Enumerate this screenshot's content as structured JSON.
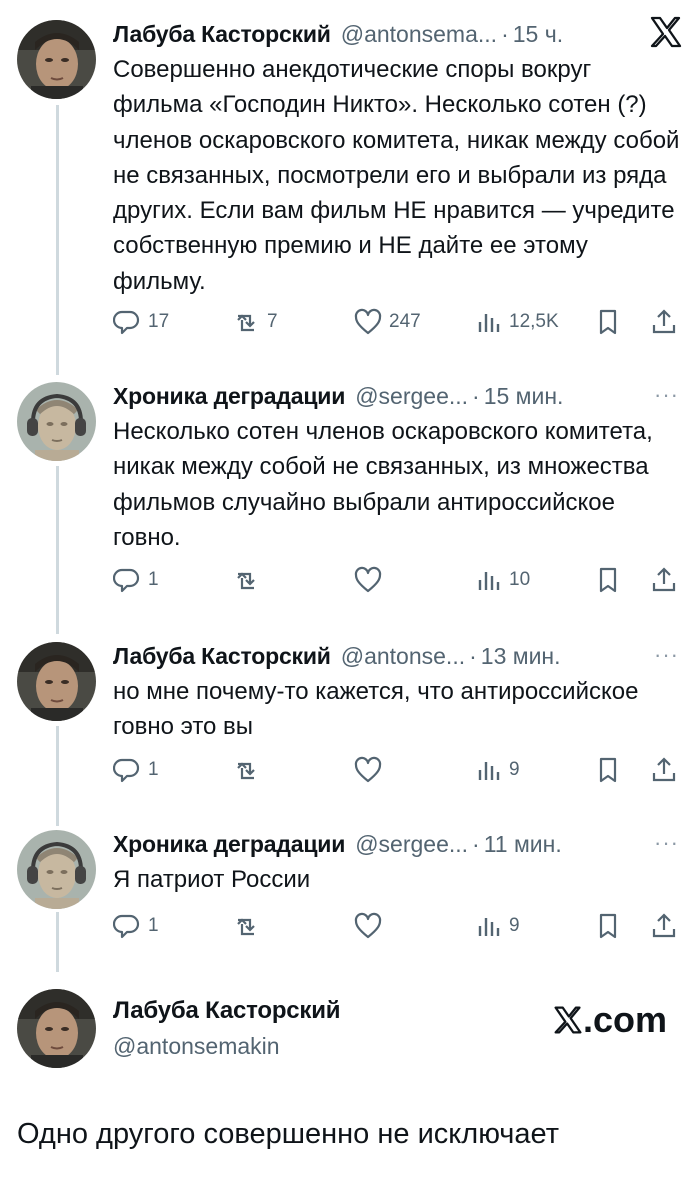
{
  "tweets": [
    {
      "author": "Лабуба Касторский",
      "handle": "@antonsema...",
      "time": "15 ч.",
      "text": "Совершенно анекдотические споры вокруг фильма «Господин Никто». Несколько сотен (?) членов оскаровского комитета, никак между собой не связанных, посмотрели его и выбрали из ряда других. Если вам фильм НЕ нравится — учредите собственную премию и НЕ дайте ее этому фильму.",
      "replies": "17",
      "retweets": "7",
      "likes": "247",
      "views": "12,5K"
    },
    {
      "author": "Хроника деградации",
      "handle": "@sergee...",
      "time": "15 мин.",
      "text": "Несколько сотен членов оскаровского комитета, никак между собой не связанных, из множества фильмов случайно выбрали антироссийское говно.",
      "replies": "1",
      "retweets": "",
      "likes": "",
      "views": "10"
    },
    {
      "author": "Лабуба Касторский",
      "handle": "@antonse...",
      "time": "13 мин.",
      "text": "но мне почему-то кажется, что антироссийское говно это вы",
      "replies": "1",
      "retweets": "",
      "likes": "",
      "views": "9"
    },
    {
      "author": "Хроника деградации",
      "handle": "@sergee...",
      "time": "11 мин.",
      "text": "Я патриот России",
      "replies": "1",
      "retweets": "",
      "likes": "",
      "views": "9"
    }
  ],
  "card": {
    "author": "Лабуба Касторский",
    "handle": "@antonsemakin",
    "brand": ".com"
  },
  "caption": "Одно другого совершенно не исключает",
  "icons": {
    "more": "more-icon",
    "x_logo": "x-logo-icon"
  },
  "colors": {
    "text": "#0f1419",
    "secondary": "#536471",
    "thread_line": "#cfd9de"
  }
}
